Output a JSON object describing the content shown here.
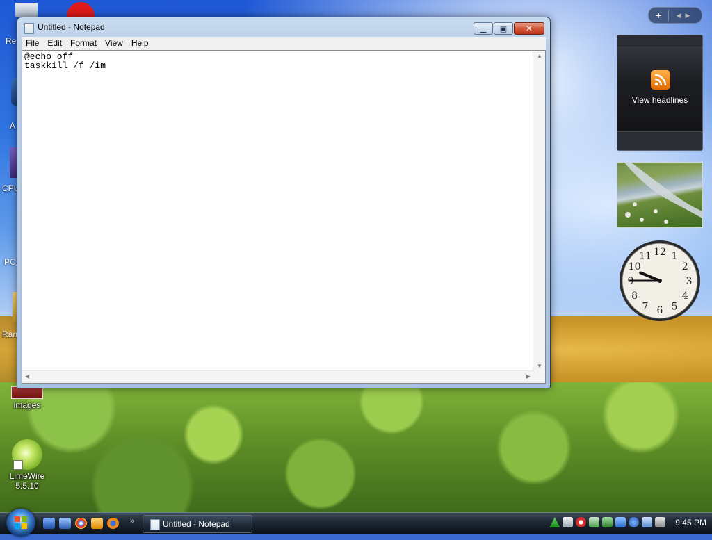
{
  "desktop": {
    "icons": [
      {
        "label": "images"
      },
      {
        "label": "LimeWire\n5.5.10"
      }
    ],
    "partial_labels": {
      "recycle": "Re",
      "a": "A",
      "cpu": "CPU",
      "pc": "PC",
      "ran": "Ran"
    }
  },
  "notepad": {
    "title": "Untitled - Notepad",
    "menu": [
      "File",
      "Edit",
      "Format",
      "View",
      "Help"
    ],
    "content": "@echo off\ntaskkill /f /im"
  },
  "gadgets": {
    "feed_label": "View headlines",
    "clock_numbers": [
      "12",
      "1",
      "2",
      "3",
      "4",
      "5",
      "6",
      "7",
      "8",
      "9",
      "10",
      "11"
    ],
    "clock_time": {
      "hour": 9,
      "minute": 45
    }
  },
  "taskbar": {
    "task_label": "Untitled - Notepad",
    "time": "9:45 PM",
    "quicklaunch_more": "»"
  },
  "colors": {
    "accent": "#1f58d6",
    "close_red": "#d45a3a",
    "rss_orange": "#f08a1c"
  }
}
